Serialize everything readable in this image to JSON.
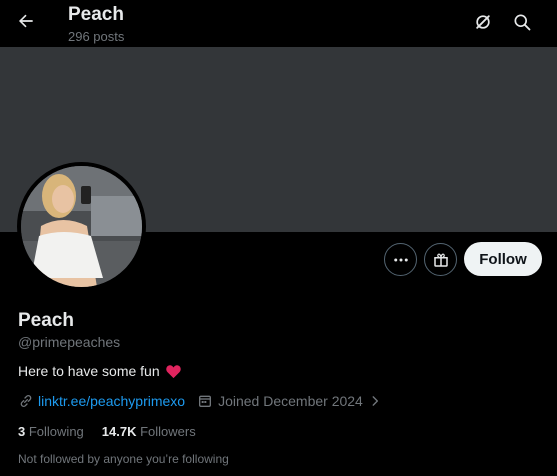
{
  "header": {
    "title": "Peach",
    "post_count": "296 posts",
    "icons": [
      "back-arrow-icon",
      "grok-icon",
      "search-icon"
    ]
  },
  "profile": {
    "display_name": "Peach",
    "handle": "@primepeaches",
    "bio": "Here to have some fun",
    "bio_emoji": "heart-emoji",
    "link_text": "linktr.ee/peachyprimexo",
    "joined": "Joined December 2024",
    "following_count": "3",
    "following_label": "Following",
    "followers_count": "14.7K",
    "followers_label": "Followers",
    "mutual_note": "Not followed by anyone you’re following"
  },
  "actions": {
    "more_icon": "more-icon",
    "subscribe_icon": "gift-icon",
    "follow_label": "Follow"
  },
  "colors": {
    "background": "#000000",
    "banner": "#333639",
    "link": "#1d9bf0",
    "secondary_text": "#71767b",
    "follow_button": "#eff3f4"
  }
}
